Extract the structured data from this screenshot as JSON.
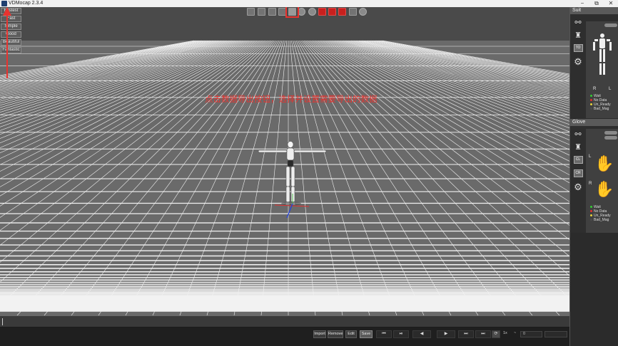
{
  "window": {
    "title": "VDMocap 2.3.4",
    "controls": [
      "−",
      "⧉",
      "✕"
    ]
  },
  "quality_menu": [
    "Fastest",
    "Fast",
    "Simple",
    "Good",
    "Beautiful",
    "Fantastic"
  ],
  "annotation": {
    "text": "点击数据导出按钮，选择并设置需要导出的数据",
    "color": "#e8332f"
  },
  "suit_panel": {
    "title": "Suit",
    "button": "TO",
    "labels": {
      "right": "R",
      "left": "L"
    },
    "legend": [
      {
        "label": "Wait",
        "color": "#33cc33"
      },
      {
        "label": "No Data",
        "color": "#e03030"
      },
      {
        "label": "Un_Ready",
        "color": "#e6d23c"
      },
      {
        "label": "Bad_Mag",
        "color": "#4a4a4a"
      }
    ]
  },
  "glove_panel": {
    "title": "Glove",
    "buttons": [
      "CL",
      "CR"
    ],
    "labels": {
      "left": "L",
      "right": "R"
    },
    "legend": [
      {
        "label": "Wait",
        "color": "#33cc33"
      },
      {
        "label": "No Data",
        "color": "#e03030"
      },
      {
        "label": "Un_Ready",
        "color": "#e6d23c"
      },
      {
        "label": "Bad_Mag",
        "color": "#4a4a4a"
      }
    ]
  },
  "bottom_bar": {
    "buttons": [
      "Import",
      "Remove",
      "Edit",
      "Save"
    ],
    "playback": [
      "⏮",
      "⏯",
      "◀",
      "▶",
      "⏭",
      "⏭"
    ],
    "speed_label": "1x",
    "frame_value": "0"
  },
  "colors": {
    "floor": "#646464",
    "grid": "#f2f2f2",
    "export_highlight": "#e8332f",
    "panel": "#2b2b2b"
  }
}
